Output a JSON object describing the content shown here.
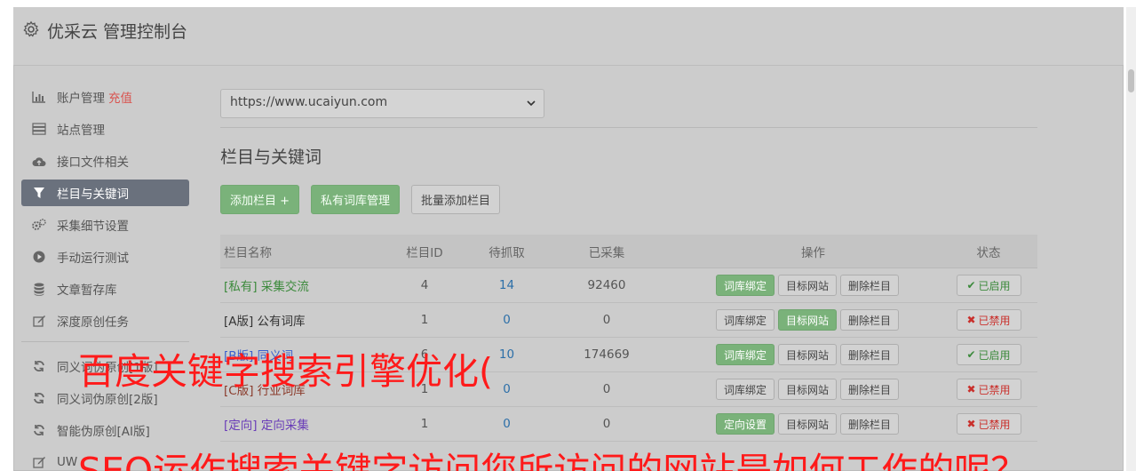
{
  "header": {
    "title": "优采云 管理控制台",
    "icon": "gear-icon"
  },
  "sidebar": {
    "items": [
      {
        "label": "账户管理",
        "extra": "充值",
        "icon": "bar-chart-icon",
        "active": false
      },
      {
        "label": "站点管理",
        "icon": "server-icon",
        "active": false
      },
      {
        "label": "接口文件相关",
        "icon": "cloud-upload-icon",
        "active": false
      },
      {
        "label": "栏目与关键词",
        "icon": "filter-icon",
        "active": true
      },
      {
        "label": "采集细节设置",
        "icon": "gears-icon",
        "active": false
      },
      {
        "label": "手动运行测试",
        "icon": "play-circle-icon",
        "active": false
      },
      {
        "label": "文章暂存库",
        "icon": "database-icon",
        "active": false
      },
      {
        "label": "深度原创任务",
        "icon": "edit-icon",
        "active": false
      }
    ],
    "items2": [
      {
        "label": "同义词伪原创[1版]",
        "icon": "refresh-icon"
      },
      {
        "label": "同义词伪原创[2版]",
        "icon": "refresh-icon"
      },
      {
        "label": "智能伪原创[AI版]",
        "icon": "refresh-icon"
      },
      {
        "label": "UW",
        "icon": "edit-icon"
      }
    ]
  },
  "site_select": {
    "value": "https://www.ucaiyun.com"
  },
  "section": {
    "title": "栏目与关键词"
  },
  "buttons": {
    "add_column": "添加栏目 +",
    "private_lib": "私有词库管理",
    "batch_add": "批量添加栏目"
  },
  "table": {
    "headers": {
      "name": "栏目名称",
      "id": "栏目ID",
      "wait": "待抓取",
      "done": "已采集",
      "ops": "操作",
      "state": "状态"
    },
    "rows": [
      {
        "name": "[私有] 采集交流",
        "id": "4",
        "wait": "14",
        "done": "92460",
        "op1": "词库绑定",
        "op2": "目标网站",
        "op3": "删除栏目",
        "state": "已启用"
      },
      {
        "name": "[A版] 公有词库",
        "id": "1",
        "wait": "0",
        "done": "0",
        "op1": "词库绑定",
        "op2": "目标网站",
        "op3": "删除栏目",
        "state": "已禁用"
      },
      {
        "name": "[B版] 同义词",
        "id": "6",
        "wait": "10",
        "done": "174669",
        "op1": "词库绑定",
        "op2": "目标网站",
        "op3": "删除栏目",
        "state": "已启用"
      },
      {
        "name": "[C版] 行业词库",
        "id": "1",
        "wait": "0",
        "done": "0",
        "op1": "词库绑定",
        "op2": "目标网站",
        "op3": "删除栏目",
        "state": "已禁用"
      },
      {
        "name": "[定向] 定向采集",
        "id": "1",
        "wait": "0",
        "done": "0",
        "op1": "定向设置",
        "op2": "目标网站",
        "op3": "删除栏目",
        "state": "已禁用"
      }
    ]
  },
  "overlay": {
    "line1": "百度关键字搜索引擎优化(",
    "line2": "SEO运作搜索关键字访问您所访问的网站是如何工作的呢？"
  },
  "colors": {
    "accent_green": "#7ab27a",
    "active_nav": "#6a717d",
    "overlay_red": "#ff1a1a"
  }
}
